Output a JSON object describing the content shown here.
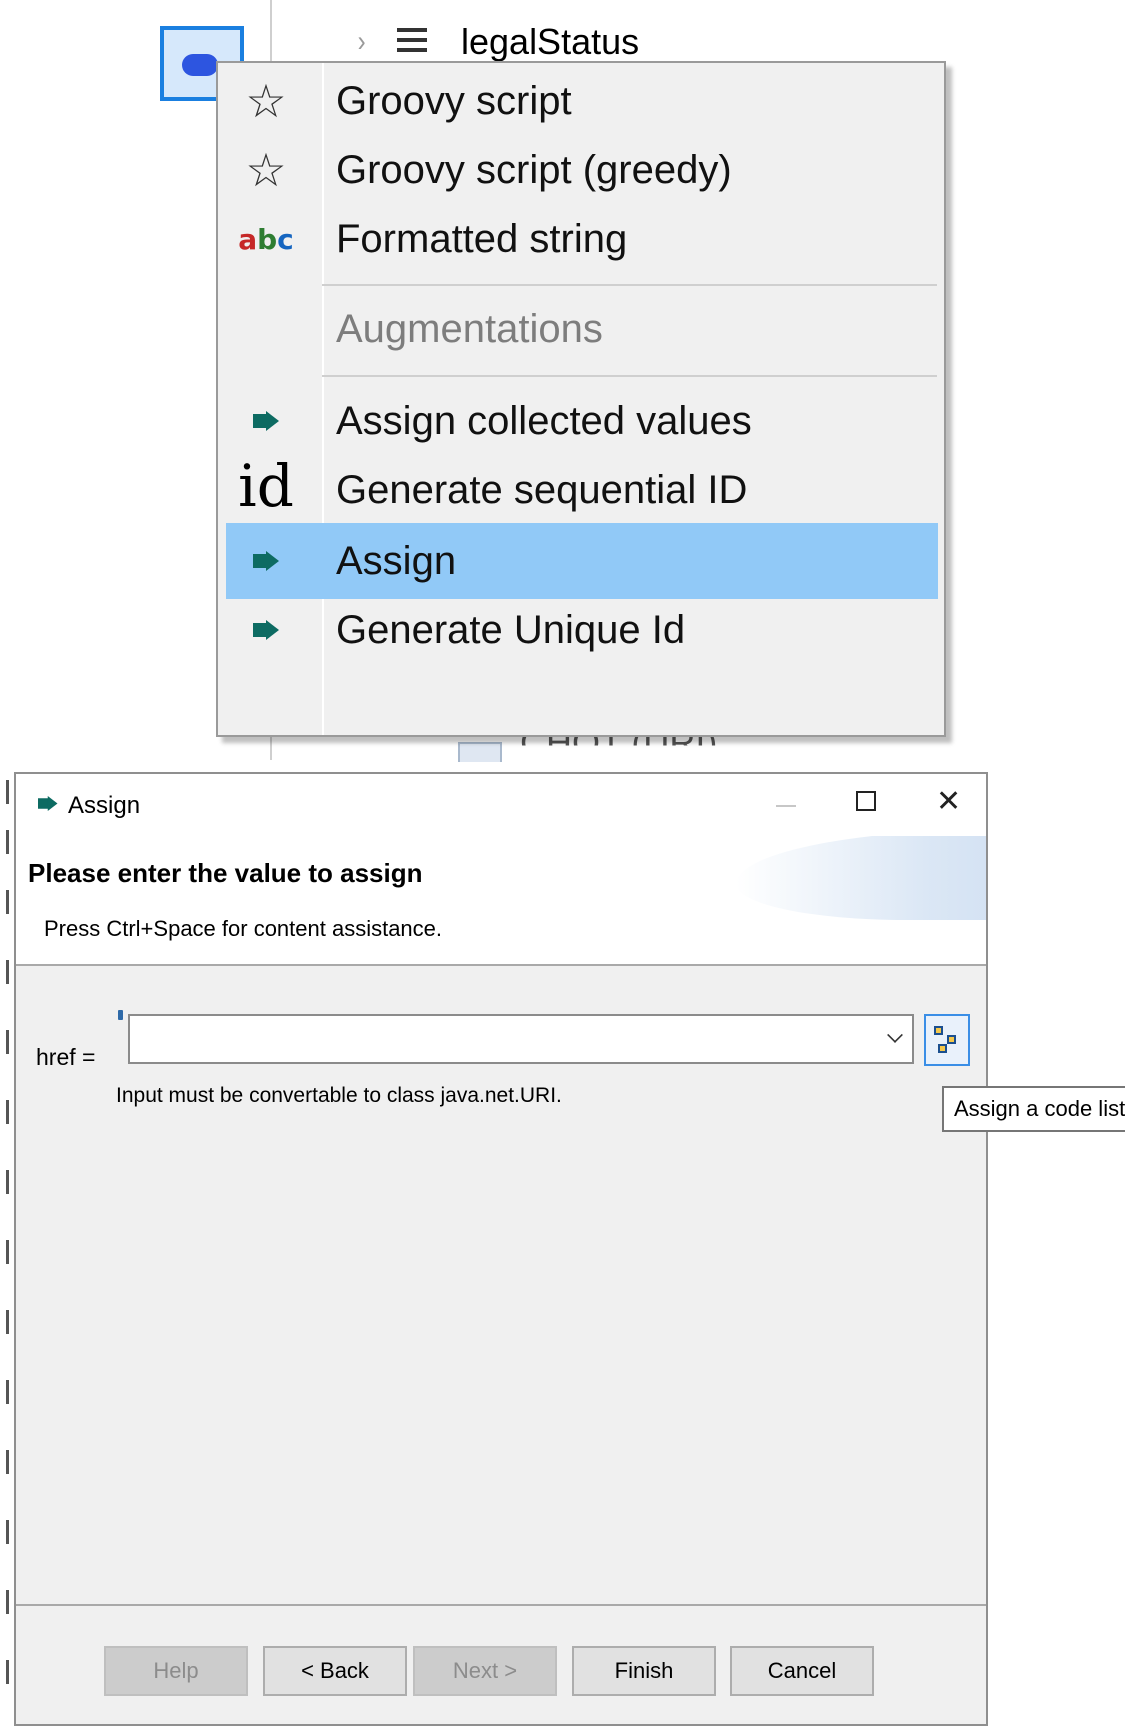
{
  "tree": {
    "node_label": "legalStatus",
    "next_node_label": "CHOT (URI)"
  },
  "context_menu": {
    "items": [
      {
        "label": "Groovy script",
        "icon": "star-icon"
      },
      {
        "label": "Groovy script (greedy)",
        "icon": "star-icon"
      },
      {
        "label": "Formatted string",
        "icon": "abc-icon"
      }
    ],
    "section_header": "Augmentations",
    "augmentation_items": [
      {
        "label": "Assign collected values",
        "icon": "assign-arrow-icon"
      },
      {
        "label": "Generate sequential ID",
        "icon": "id-icon"
      },
      {
        "label": "Assign",
        "icon": "assign-arrow-icon",
        "highlighted": true
      },
      {
        "label": "Generate Unique Id",
        "icon": "assign-arrow-icon"
      }
    ],
    "abc_glyph": "abc",
    "id_glyph": "id",
    "colors": {
      "highlight": "#91c9f7",
      "menu_bg": "#f0f0f0"
    }
  },
  "dialog": {
    "title": "Assign",
    "banner_title": "Please enter the value to assign",
    "banner_message": "Press Ctrl+Space for content assistance.",
    "field_label": "href  =",
    "field_value": "",
    "field_hint": "Input must be convertable to class java.net.URI.",
    "buttons": {
      "help": "Help",
      "back": "< Back",
      "next": "Next >",
      "finish": "Finish",
      "cancel": "Cancel"
    },
    "tooltip": "Assign a code list"
  }
}
